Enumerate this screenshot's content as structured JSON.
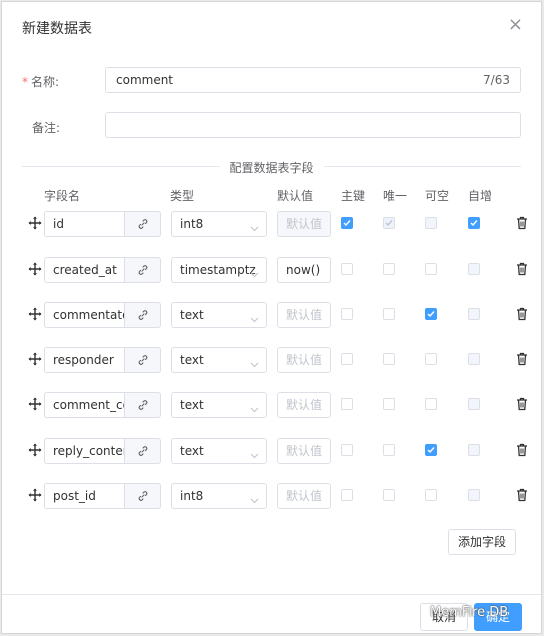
{
  "dialog": {
    "title": "新建数据表",
    "close_symbol": "×",
    "name_label": "名称:",
    "name_required_mark": "*",
    "name_value": "comment",
    "name_counter": "7/63",
    "remark_label": "备注:",
    "remark_value": "",
    "section_title": "配置数据表字段",
    "add_field_label": "添加字段",
    "cancel_label": "取消",
    "confirm_label": "确定",
    "watermark": "MemFire DB"
  },
  "columns": {
    "field_name": "字段名",
    "type": "类型",
    "default": "默认值",
    "primary": "主键",
    "unique": "唯一",
    "nullable": "可空",
    "auto_inc": "自增"
  },
  "fields": [
    {
      "name": "id",
      "type": "int8",
      "default": "默认值",
      "default_is_placeholder": true,
      "default_disabled": true,
      "primary": "checked",
      "unique": "disabled-checked",
      "nullable": "disabled",
      "auto": "checked"
    },
    {
      "name": "created_at",
      "type": "timestamptz",
      "default": "now()",
      "default_is_placeholder": false,
      "default_disabled": false,
      "primary": "unchecked",
      "unique": "unchecked",
      "nullable": "unchecked",
      "auto": "disabled"
    },
    {
      "name": "commentator",
      "type": "text",
      "default": "默认值",
      "default_is_placeholder": true,
      "default_disabled": false,
      "primary": "unchecked",
      "unique": "unchecked",
      "nullable": "checked",
      "auto": "disabled"
    },
    {
      "name": "responder",
      "type": "text",
      "default": "默认值",
      "default_is_placeholder": true,
      "default_disabled": false,
      "primary": "unchecked",
      "unique": "unchecked",
      "nullable": "unchecked",
      "auto": "disabled"
    },
    {
      "name": "comment_content",
      "type": "text",
      "default": "默认值",
      "default_is_placeholder": true,
      "default_disabled": false,
      "primary": "unchecked",
      "unique": "unchecked",
      "nullable": "unchecked",
      "auto": "disabled"
    },
    {
      "name": "reply_content",
      "type": "text",
      "default": "默认值",
      "default_is_placeholder": true,
      "default_disabled": false,
      "primary": "unchecked",
      "unique": "unchecked",
      "nullable": "checked",
      "auto": "disabled"
    },
    {
      "name": "post_id",
      "type": "int8",
      "default": "默认值",
      "default_is_placeholder": true,
      "default_disabled": false,
      "primary": "unchecked",
      "unique": "unchecked",
      "nullable": "unchecked",
      "auto": "disabled"
    }
  ],
  "colors": {
    "accent": "#409eff",
    "required": "#f56c6c"
  }
}
